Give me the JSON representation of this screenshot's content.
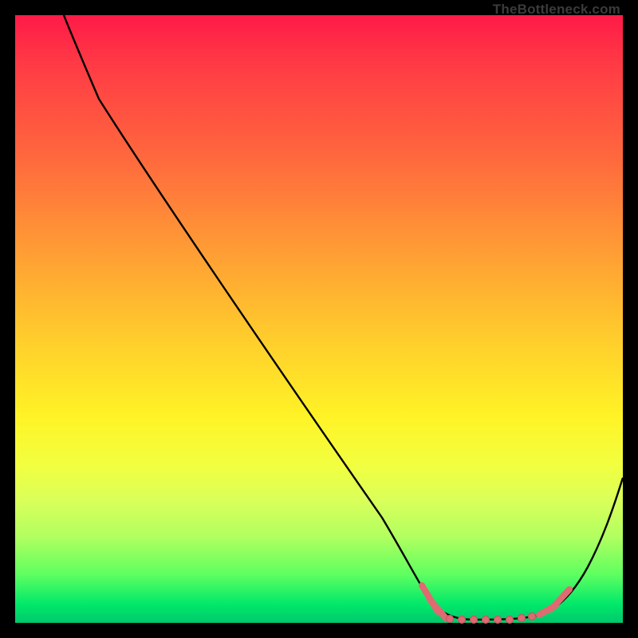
{
  "attribution": "TheBottleneck.com",
  "colors": {
    "black": "#000000",
    "marker": "#e06a72"
  },
  "chart_data": {
    "type": "line",
    "title": "",
    "xlabel": "",
    "ylabel": "",
    "xlim": [
      0,
      100
    ],
    "ylim": [
      0,
      100
    ],
    "curve": [
      {
        "x": 8,
        "y": 100
      },
      {
        "x": 13,
        "y": 93
      },
      {
        "x": 20,
        "y": 83
      },
      {
        "x": 30,
        "y": 68
      },
      {
        "x": 40,
        "y": 53
      },
      {
        "x": 50,
        "y": 38
      },
      {
        "x": 60,
        "y": 22
      },
      {
        "x": 65,
        "y": 11
      },
      {
        "x": 68,
        "y": 5
      },
      {
        "x": 72,
        "y": 2
      },
      {
        "x": 78,
        "y": 2
      },
      {
        "x": 84,
        "y": 2
      },
      {
        "x": 88,
        "y": 4
      },
      {
        "x": 92,
        "y": 8
      },
      {
        "x": 96,
        "y": 16
      },
      {
        "x": 100,
        "y": 26
      }
    ],
    "highlight_band_x": [
      67,
      89
    ],
    "markers_x": [
      67,
      69,
      71,
      73,
      75,
      77,
      79,
      81,
      83,
      85,
      87,
      89
    ]
  }
}
